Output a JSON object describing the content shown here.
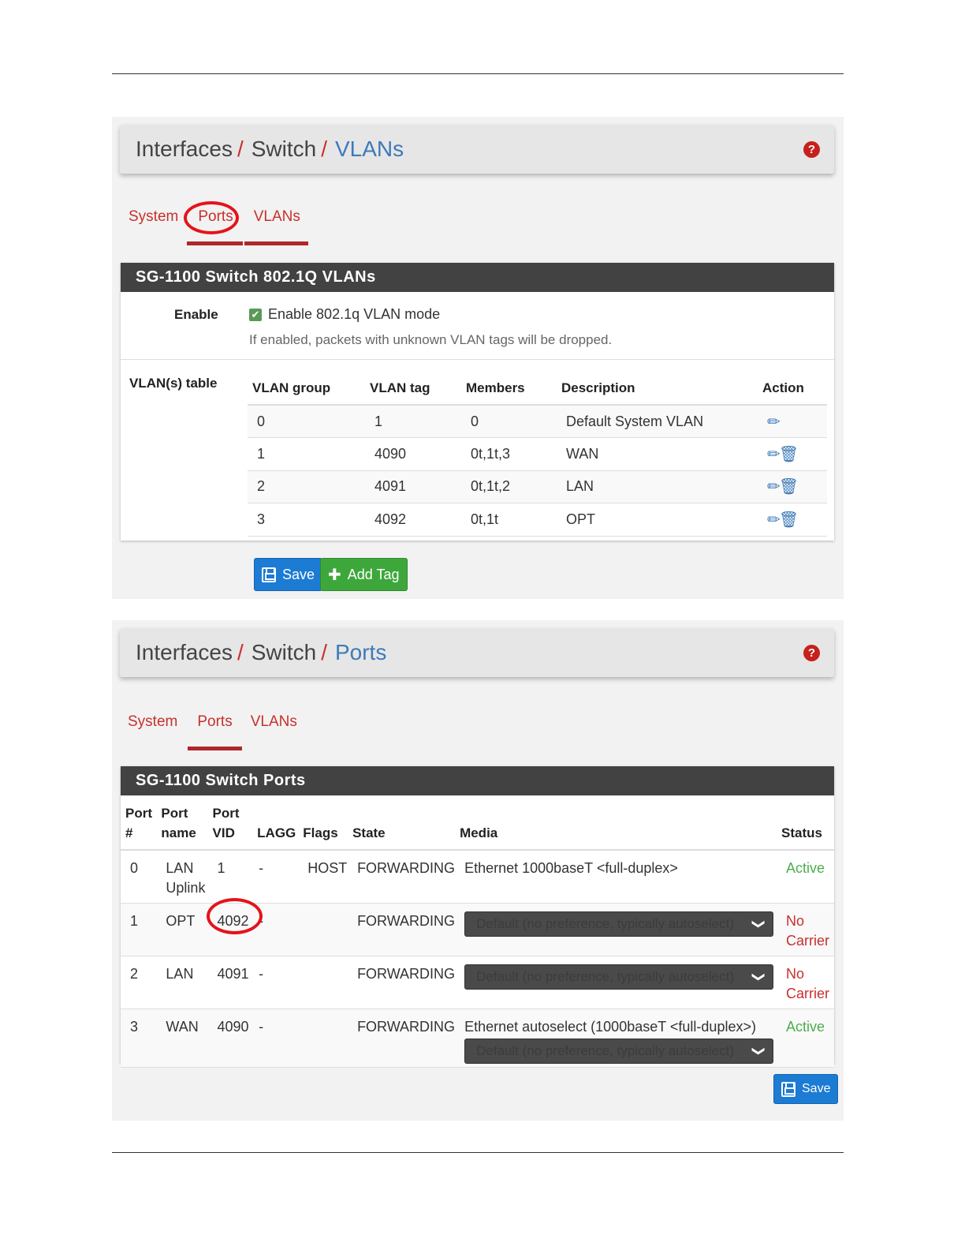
{
  "shot1": {
    "breadcrumb": [
      "Interfaces",
      "Switch",
      "VLANs"
    ],
    "tabs": [
      "System",
      "Ports",
      "VLANs"
    ],
    "panel_title": "SG-1100 Switch 802.1Q VLANs",
    "enable_label": "Enable",
    "enable_checkbox_label": "Enable 802.1q VLAN mode",
    "enable_help": "If enabled, packets with unknown VLAN tags will be dropped.",
    "vlan_table_label": "VLAN(s) table",
    "columns": [
      "VLAN group",
      "VLAN tag",
      "Members",
      "Description",
      "Action"
    ],
    "rows": [
      {
        "group": "0",
        "tag": "1",
        "members": "0",
        "description": "Default System VLAN",
        "actions": [
          "pencil-icon"
        ]
      },
      {
        "group": "1",
        "tag": "4090",
        "members": "0t,1t,3",
        "description": "WAN",
        "actions": [
          "pencil-icon",
          "trash-icon"
        ]
      },
      {
        "group": "2",
        "tag": "4091",
        "members": "0t,1t,2",
        "description": "LAN",
        "actions": [
          "pencil-icon",
          "trash-icon"
        ]
      },
      {
        "group": "3",
        "tag": "4092",
        "members": "0t,1t",
        "description": "OPT",
        "actions": [
          "pencil-icon",
          "trash-icon"
        ]
      }
    ],
    "save_label": "Save",
    "add_tag_label": "Add Tag"
  },
  "shot2": {
    "breadcrumb": [
      "Interfaces",
      "Switch",
      "Ports"
    ],
    "tabs": [
      "System",
      "Ports",
      "VLANs"
    ],
    "panel_title": "SG-1100 Switch Ports",
    "columns": [
      {
        "line1": "Port",
        "line2": "#"
      },
      {
        "line1": "Port",
        "line2": "name"
      },
      {
        "line1": "Port",
        "line2": "VID"
      },
      {
        "line1": "",
        "line2": "LAGG"
      },
      {
        "line1": "",
        "line2": "Flags"
      },
      {
        "line1": "",
        "line2": "State"
      },
      {
        "line1": "",
        "line2": "Media"
      },
      {
        "line1": "",
        "line2": "Status"
      }
    ],
    "rows": [
      {
        "num": "0",
        "name": "LAN Uplink",
        "vid": "1",
        "lagg": "-",
        "flags": "HOST",
        "state": "FORWARDING",
        "media_text": "Ethernet 1000baseT <full-duplex>",
        "media_select": "",
        "status": "Active"
      },
      {
        "num": "1",
        "name": "OPT",
        "vid": "4092",
        "lagg": "-",
        "flags": "",
        "state": "FORWARDING",
        "media_text": "",
        "media_select": "Default (no preference, typically autoselect)",
        "status": "No Carrier"
      },
      {
        "num": "2",
        "name": "LAN",
        "vid": "4091",
        "lagg": "-",
        "flags": "",
        "state": "FORWARDING",
        "media_text": "",
        "media_select": "Default (no preference, typically autoselect)",
        "status": "No Carrier"
      },
      {
        "num": "3",
        "name": "WAN",
        "vid": "4090",
        "lagg": "-",
        "flags": "",
        "state": "FORWARDING",
        "media_text": "Ethernet autoselect (1000baseT <full-duplex>)",
        "media_select": "Default (no preference, typically autoselect)",
        "status": "Active"
      }
    ],
    "save_label": "Save"
  },
  "colors": {
    "accent_red": "#c9302c",
    "active_link": "#3d7ab8",
    "status_green": "#4cae4c",
    "button_blue": "#1c7bd3",
    "button_green": "#3ea73c",
    "panel_header": "#424242"
  }
}
